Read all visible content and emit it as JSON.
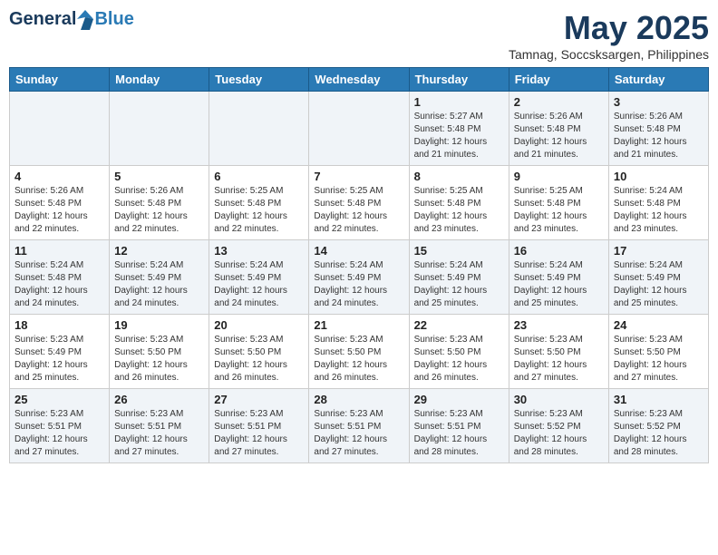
{
  "header": {
    "logo_general": "General",
    "logo_blue": "Blue",
    "month": "May 2025",
    "location": "Tamnag, Soccsksargen, Philippines"
  },
  "weekdays": [
    "Sunday",
    "Monday",
    "Tuesday",
    "Wednesday",
    "Thursday",
    "Friday",
    "Saturday"
  ],
  "weeks": [
    [
      {
        "day": "",
        "info": ""
      },
      {
        "day": "",
        "info": ""
      },
      {
        "day": "",
        "info": ""
      },
      {
        "day": "",
        "info": ""
      },
      {
        "day": "1",
        "info": "Sunrise: 5:27 AM\nSunset: 5:48 PM\nDaylight: 12 hours\nand 21 minutes."
      },
      {
        "day": "2",
        "info": "Sunrise: 5:26 AM\nSunset: 5:48 PM\nDaylight: 12 hours\nand 21 minutes."
      },
      {
        "day": "3",
        "info": "Sunrise: 5:26 AM\nSunset: 5:48 PM\nDaylight: 12 hours\nand 21 minutes."
      }
    ],
    [
      {
        "day": "4",
        "info": "Sunrise: 5:26 AM\nSunset: 5:48 PM\nDaylight: 12 hours\nand 22 minutes."
      },
      {
        "day": "5",
        "info": "Sunrise: 5:26 AM\nSunset: 5:48 PM\nDaylight: 12 hours\nand 22 minutes."
      },
      {
        "day": "6",
        "info": "Sunrise: 5:25 AM\nSunset: 5:48 PM\nDaylight: 12 hours\nand 22 minutes."
      },
      {
        "day": "7",
        "info": "Sunrise: 5:25 AM\nSunset: 5:48 PM\nDaylight: 12 hours\nand 22 minutes."
      },
      {
        "day": "8",
        "info": "Sunrise: 5:25 AM\nSunset: 5:48 PM\nDaylight: 12 hours\nand 23 minutes."
      },
      {
        "day": "9",
        "info": "Sunrise: 5:25 AM\nSunset: 5:48 PM\nDaylight: 12 hours\nand 23 minutes."
      },
      {
        "day": "10",
        "info": "Sunrise: 5:24 AM\nSunset: 5:48 PM\nDaylight: 12 hours\nand 23 minutes."
      }
    ],
    [
      {
        "day": "11",
        "info": "Sunrise: 5:24 AM\nSunset: 5:48 PM\nDaylight: 12 hours\nand 24 minutes."
      },
      {
        "day": "12",
        "info": "Sunrise: 5:24 AM\nSunset: 5:49 PM\nDaylight: 12 hours\nand 24 minutes."
      },
      {
        "day": "13",
        "info": "Sunrise: 5:24 AM\nSunset: 5:49 PM\nDaylight: 12 hours\nand 24 minutes."
      },
      {
        "day": "14",
        "info": "Sunrise: 5:24 AM\nSunset: 5:49 PM\nDaylight: 12 hours\nand 24 minutes."
      },
      {
        "day": "15",
        "info": "Sunrise: 5:24 AM\nSunset: 5:49 PM\nDaylight: 12 hours\nand 25 minutes."
      },
      {
        "day": "16",
        "info": "Sunrise: 5:24 AM\nSunset: 5:49 PM\nDaylight: 12 hours\nand 25 minutes."
      },
      {
        "day": "17",
        "info": "Sunrise: 5:24 AM\nSunset: 5:49 PM\nDaylight: 12 hours\nand 25 minutes."
      }
    ],
    [
      {
        "day": "18",
        "info": "Sunrise: 5:23 AM\nSunset: 5:49 PM\nDaylight: 12 hours\nand 25 minutes."
      },
      {
        "day": "19",
        "info": "Sunrise: 5:23 AM\nSunset: 5:50 PM\nDaylight: 12 hours\nand 26 minutes."
      },
      {
        "day": "20",
        "info": "Sunrise: 5:23 AM\nSunset: 5:50 PM\nDaylight: 12 hours\nand 26 minutes."
      },
      {
        "day": "21",
        "info": "Sunrise: 5:23 AM\nSunset: 5:50 PM\nDaylight: 12 hours\nand 26 minutes."
      },
      {
        "day": "22",
        "info": "Sunrise: 5:23 AM\nSunset: 5:50 PM\nDaylight: 12 hours\nand 26 minutes."
      },
      {
        "day": "23",
        "info": "Sunrise: 5:23 AM\nSunset: 5:50 PM\nDaylight: 12 hours\nand 27 minutes."
      },
      {
        "day": "24",
        "info": "Sunrise: 5:23 AM\nSunset: 5:50 PM\nDaylight: 12 hours\nand 27 minutes."
      }
    ],
    [
      {
        "day": "25",
        "info": "Sunrise: 5:23 AM\nSunset: 5:51 PM\nDaylight: 12 hours\nand 27 minutes."
      },
      {
        "day": "26",
        "info": "Sunrise: 5:23 AM\nSunset: 5:51 PM\nDaylight: 12 hours\nand 27 minutes."
      },
      {
        "day": "27",
        "info": "Sunrise: 5:23 AM\nSunset: 5:51 PM\nDaylight: 12 hours\nand 27 minutes."
      },
      {
        "day": "28",
        "info": "Sunrise: 5:23 AM\nSunset: 5:51 PM\nDaylight: 12 hours\nand 27 minutes."
      },
      {
        "day": "29",
        "info": "Sunrise: 5:23 AM\nSunset: 5:51 PM\nDaylight: 12 hours\nand 28 minutes."
      },
      {
        "day": "30",
        "info": "Sunrise: 5:23 AM\nSunset: 5:52 PM\nDaylight: 12 hours\nand 28 minutes."
      },
      {
        "day": "31",
        "info": "Sunrise: 5:23 AM\nSunset: 5:52 PM\nDaylight: 12 hours\nand 28 minutes."
      }
    ]
  ]
}
